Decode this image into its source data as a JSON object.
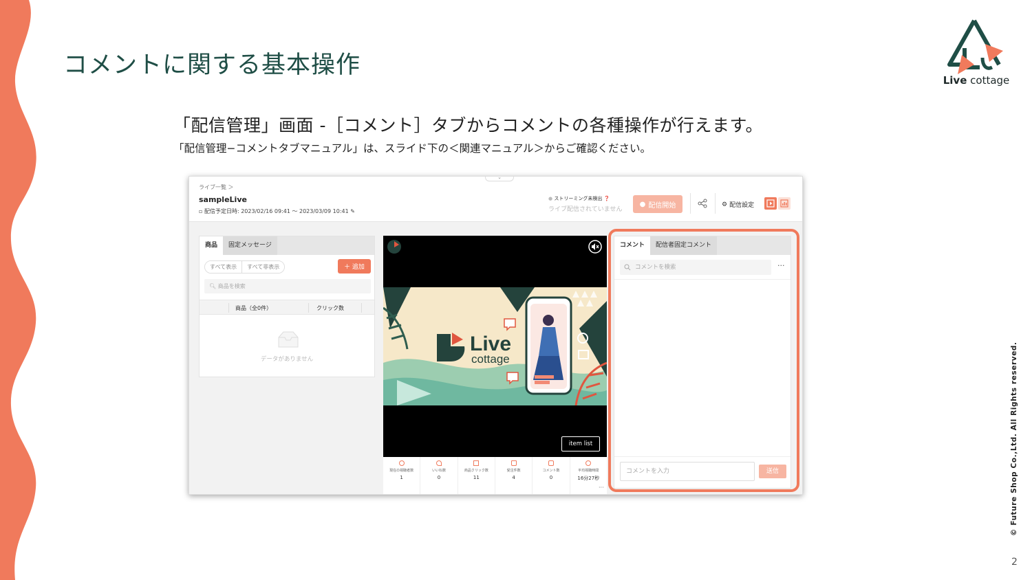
{
  "slide": {
    "title": "コメントに関する基本操作",
    "subtitle": "「配信管理」画面 -［コメント］タブからコメントの各種操作が行えます。",
    "note": "「配信管理−コメントタブマニュアル」は、スライド下の＜関連マニュアル＞からご確認ください。",
    "copyright": "© Future Shop Co.,Ltd. All Rights reserved.",
    "page_number": "2"
  },
  "brand": {
    "logo_bold": "Live",
    "logo_light": " cottage",
    "accent": "#f07a5c",
    "dark_green": "#1f4e46"
  },
  "app": {
    "breadcrumb": "ライブ一覧 ＞",
    "live_name": "sampleLive",
    "schedule": "配信予定日時: 2023/02/16 09:41 〜 2023/03/09 10:41",
    "stream_status": "ストリーミング未検出",
    "stream_sub": "ライブ配信されていません",
    "start_button": "配信開始",
    "settings": "配信設定",
    "left_tabs": [
      "商品",
      "固定メッセージ"
    ],
    "show_all": "すべて表示",
    "hide_all": "すべて非表示",
    "add_button": "＋ 追加",
    "product_search_placeholder": "商品を検索",
    "col_product": "商品（全0件）",
    "col_clicks": "クリック数",
    "no_data": "データがありません",
    "item_list_button": "item list",
    "stats": [
      {
        "label": "現在の視聴者数",
        "value": "1"
      },
      {
        "label": "いいね数",
        "value": "0"
      },
      {
        "label": "商品クリック数",
        "value": "11"
      },
      {
        "label": "受注件数",
        "value": "4"
      },
      {
        "label": "コメント数",
        "value": "0"
      },
      {
        "label": "平均視聴時間",
        "value": "16分27秒"
      }
    ],
    "comment_tabs": [
      "コメント",
      "配信者固定コメント"
    ],
    "comment_search_placeholder": "コメントを検索",
    "more": "···",
    "comment_input_placeholder": "コメントを入力",
    "send_button": "送信",
    "video_logo_big": "Live",
    "video_logo_small": "cottage"
  }
}
